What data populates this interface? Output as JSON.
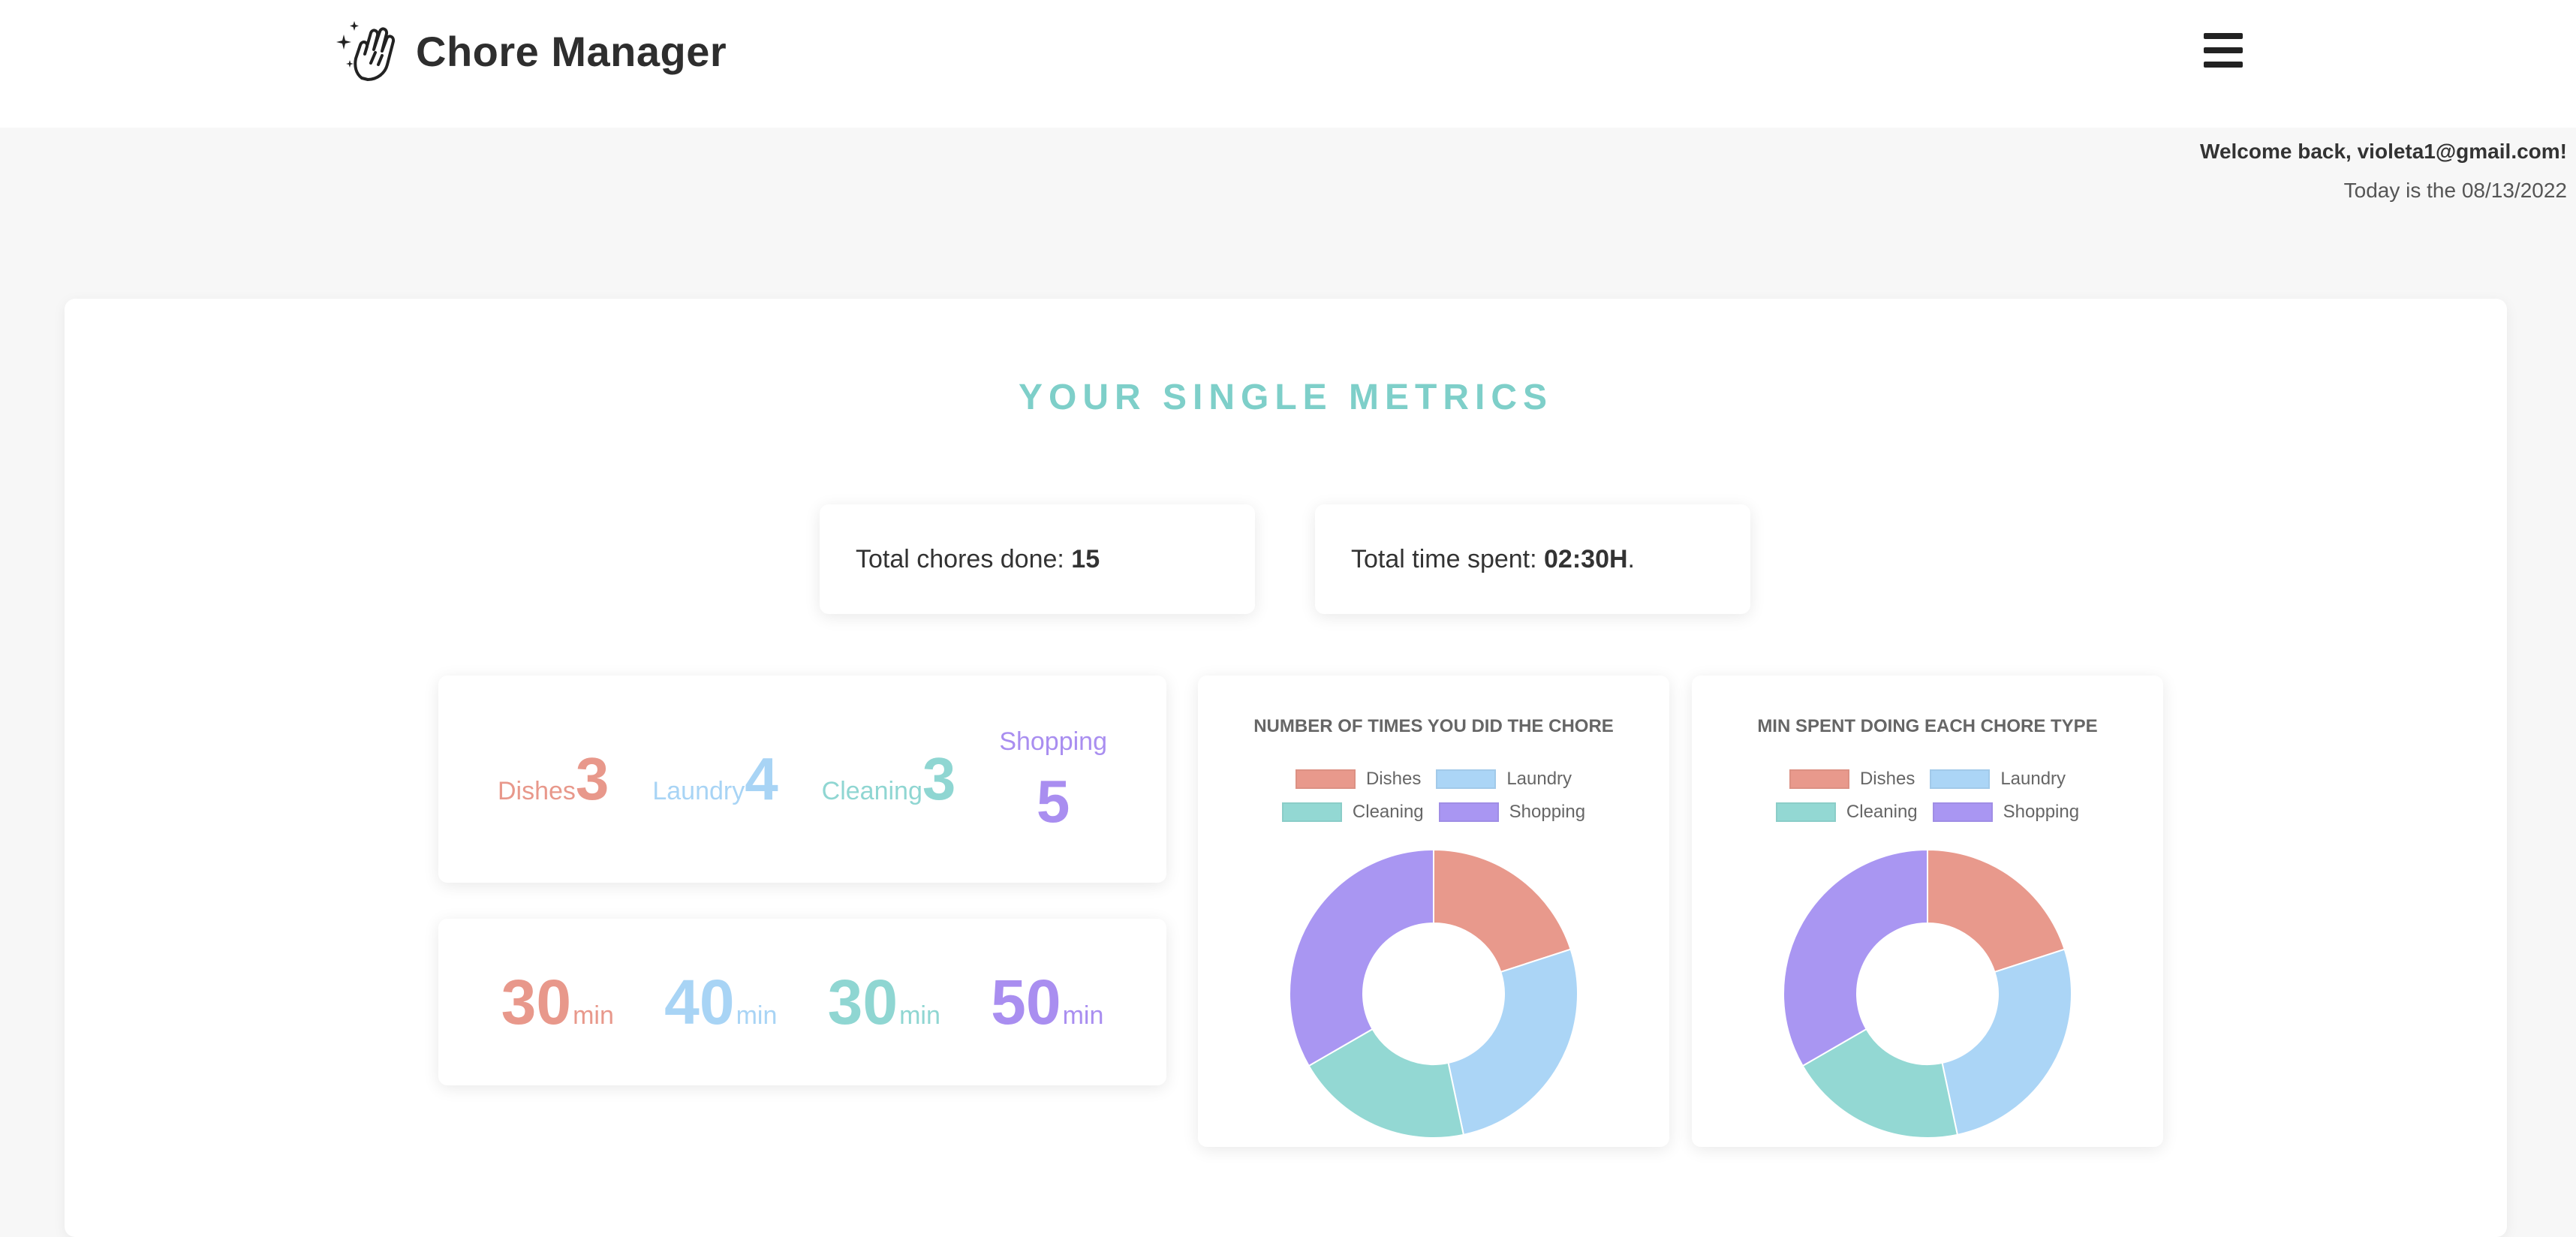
{
  "header": {
    "app_title": "Chore Manager",
    "logo_icon": "cleaning-hand-icon",
    "menu_icon": "hamburger-menu-icon"
  },
  "user": {
    "welcome": "Welcome back, violeta1@gmail.com!",
    "today": "Today is the 08/13/2022"
  },
  "metrics": {
    "title": "YOUR SINGLE METRICS",
    "total_chores_label": "Total chores done: ",
    "total_chores_value": "15",
    "total_time_label": "Total time spent: ",
    "total_time_value": "02:30H",
    "total_time_suffix": ".",
    "counts": [
      {
        "label": "Dishes",
        "value": "3",
        "color": "#e8988b"
      },
      {
        "label": "Laundry",
        "value": "4",
        "color": "#a8d4f5"
      },
      {
        "label": "Cleaning",
        "value": "3",
        "color": "#8fd6d2"
      },
      {
        "label": "Shopping",
        "value": "5",
        "color": "#a98ef0"
      }
    ],
    "minutes": [
      {
        "value": "30",
        "unit": "min",
        "color": "#e8988b"
      },
      {
        "value": "40",
        "unit": "min",
        "color": "#a8d4f5"
      },
      {
        "value": "30",
        "unit": "min",
        "color": "#8fd6d2"
      },
      {
        "value": "50",
        "unit": "min",
        "color": "#a98ef0"
      }
    ]
  },
  "chart_data": [
    {
      "type": "pie",
      "title": "NUMBER OF TIMES YOU DID THE CHORE",
      "categories": [
        "Dishes",
        "Laundry",
        "Cleaning",
        "Shopping"
      ],
      "values": [
        3,
        4,
        3,
        5
      ],
      "colors": [
        "#e8998c",
        "#abd5f6",
        "#93d8d3",
        "#a996f2"
      ],
      "legend": "top"
    },
    {
      "type": "pie",
      "title": "MIN SPENT DOING EACH CHORE TYPE",
      "categories": [
        "Dishes",
        "Laundry",
        "Cleaning",
        "Shopping"
      ],
      "values": [
        30,
        40,
        30,
        50
      ],
      "colors": [
        "#e8998c",
        "#abd5f6",
        "#93d8d3",
        "#a996f2"
      ],
      "legend": "top"
    }
  ]
}
